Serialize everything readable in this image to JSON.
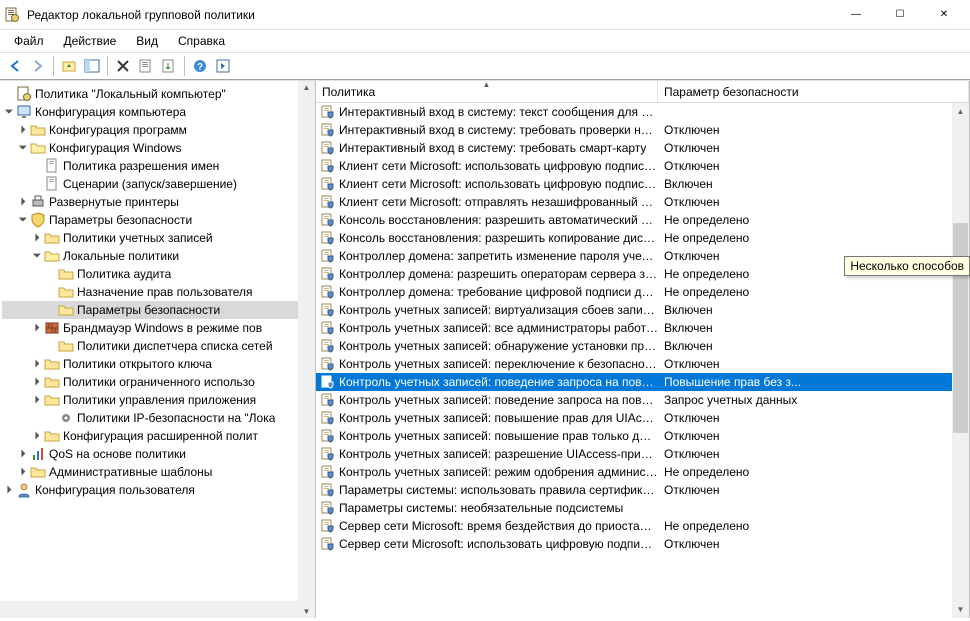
{
  "window": {
    "title": "Редактор локальной групповой политики",
    "minimize": "—",
    "maximize": "☐",
    "close": "✕"
  },
  "menu": {
    "file": "Файл",
    "action": "Действие",
    "view": "Вид",
    "help": "Справка"
  },
  "tree": {
    "root": "Политика \"Локальный компьютер\"",
    "comp_config": "Конфигурация компьютера",
    "user_config": "Конфигурация пользователя",
    "soft_config": "Конфигурация программ",
    "win_config": "Конфигурация Windows",
    "name_policy": "Политика разрешения имен",
    "scripts": "Сценарии (запуск/завершение)",
    "printers": "Развернутые принтеры",
    "sec_params": "Параметры безопасности",
    "acct_policies": "Политики учетных записей",
    "local_policies": "Локальные политики",
    "audit": "Политика аудита",
    "rights": "Назначение прав пользователя",
    "sec_options": "Параметры безопасности",
    "firewall": "Брандмауэр Windows в режиме пов",
    "netlist": "Политики диспетчера списка сетей",
    "pubkey": "Политики открытого ключа",
    "software_restrict": "Политики ограниченного использо",
    "appctrl": "Политики управления приложения",
    "ipsec": "Политики IP-безопасности на \"Лока",
    "advaudit": "Конфигурация расширенной полит",
    "qos": "QoS на основе политики",
    "admt": "Административные шаблоны"
  },
  "list": {
    "col1": "Политика",
    "col2": "Параметр безопасности",
    "rows": [
      {
        "p": "Интерактивный вход в систему: текст сообщения для по...",
        "v": ""
      },
      {
        "p": "Интерактивный вход в систему: требовать проверки на к...",
        "v": "Отключен"
      },
      {
        "p": "Интерактивный вход в систему: требовать смарт-карту",
        "v": "Отключен"
      },
      {
        "p": "Клиент сети Microsoft: использовать цифровую подпись ...",
        "v": "Отключен"
      },
      {
        "p": "Клиент сети Microsoft: использовать цифровую подпись ...",
        "v": "Включен"
      },
      {
        "p": "Клиент сети Microsoft: отправлять незашифрованный па...",
        "v": "Отключен"
      },
      {
        "p": "Консоль восстановления: разрешить автоматический вх...",
        "v": "Не определено"
      },
      {
        "p": "Консоль восстановления: разрешить копирование диске...",
        "v": "Не определено"
      },
      {
        "p": "Контроллер домена: запретить изменение пароля учетн...",
        "v": "Отключен"
      },
      {
        "p": "Контроллер домена: разрешить операторам сервера зад...",
        "v": "Не определено"
      },
      {
        "p": "Контроллер домена: требование цифровой подписи для ...",
        "v": "Не определено"
      },
      {
        "p": "Контроль учетных записей: виртуализация сбоев записи ...",
        "v": "Включен"
      },
      {
        "p": "Контроль учетных записей: все администраторы работа...",
        "v": "Включен"
      },
      {
        "p": "Контроль учетных записей: обнаружение установки при...",
        "v": "Включен"
      },
      {
        "p": "Контроль учетных записей: переключение к безопасном...",
        "v": "Отключен"
      },
      {
        "p": "Контроль учетных записей: поведение запроса на повы...",
        "v": "Повышение прав без з...",
        "sel": true
      },
      {
        "p": "Контроль учетных записей: поведение запроса на повы...",
        "v": "Запрос учетных данных"
      },
      {
        "p": "Контроль учетных записей: повышение прав для UIAcces...",
        "v": "Отключен"
      },
      {
        "p": "Контроль учетных записей: повышение прав только для ...",
        "v": "Отключен"
      },
      {
        "p": "Контроль учетных записей: разрешение UIAccess-прило...",
        "v": "Отключен"
      },
      {
        "p": "Контроль учетных записей: режим одобрения админист...",
        "v": "Не определено"
      },
      {
        "p": "Параметры системы: использовать правила сертификат...",
        "v": "Отключен"
      },
      {
        "p": "Параметры системы: необязательные подсистемы",
        "v": ""
      },
      {
        "p": "Сервер сети Microsoft: время бездействия до приостанов...",
        "v": "Не определено"
      },
      {
        "p": "Сервер сети Microsoft: использовать цифровую подпись ...",
        "v": "Отключен"
      }
    ]
  },
  "tooltip": "Несколько способов"
}
